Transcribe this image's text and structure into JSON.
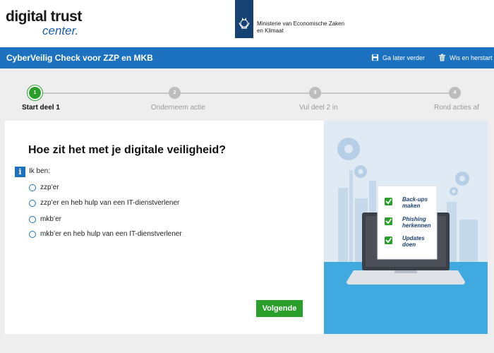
{
  "header": {
    "logo_line1": "digital trust",
    "logo_line2": "center.",
    "ministry_line1": "Ministerie van Economische Zaken",
    "ministry_line2": "en Klimaat"
  },
  "navbar": {
    "title": "CyberVeilig Check voor ZZP en MKB",
    "save_label": "Ga later verder",
    "reset_label": "Wis en herstart",
    "color": "#1d72c0"
  },
  "stepper": {
    "steps": [
      {
        "number": "1",
        "label": "Start deel 1",
        "active": true
      },
      {
        "number": "2",
        "label": "Onderneem actie",
        "active": false
      },
      {
        "number": "3",
        "label": "Vul deel 2 in",
        "active": false
      },
      {
        "number": "4",
        "label": "Rond acties af",
        "active": false
      }
    ],
    "active_color": "#2aa02a"
  },
  "question": {
    "title": "Hoe zit het met je digitale veiligheid?",
    "info_icon": "i",
    "prompt": "Ik ben:",
    "options": [
      "zzp’er",
      "zzp’er en heb hulp van een IT-dienstverlener",
      "mkb’er",
      "mkb’er en heb hulp van een IT-dienstverlener"
    ],
    "next_label": "Volgende"
  },
  "illustration": {
    "checklist": [
      {
        "line1": "Back-ups",
        "line2": "maken"
      },
      {
        "line1": "Phishing",
        "line2": "herkennen"
      },
      {
        "line1": "Updates",
        "line2": "doen"
      }
    ]
  }
}
